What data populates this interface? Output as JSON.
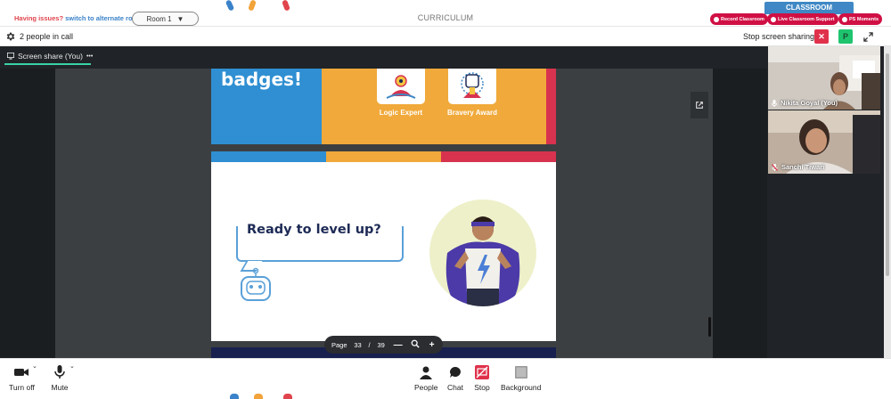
{
  "header": {
    "issues_text": "Having issues?",
    "alt_room_link": "switch to alternate room",
    "room_label": "Room 1",
    "title": "CURRICULUM",
    "classroom_tab": "CLASSROOM",
    "record_button": "Record Classroom",
    "support_button": "Live Classroom Support",
    "moments_button": "PS Moments"
  },
  "callbar": {
    "people_count": "2 people in call",
    "stop_sharing": "Stop screen sharing",
    "p_button": "P"
  },
  "meeting": {
    "share_label": "Screen share (You)",
    "share_more": "•••"
  },
  "slides": {
    "badges_text": "badges!",
    "badge1_label": "Logic Expert",
    "badge2_label": "Bravery Award",
    "ready_text": "Ready to level up?"
  },
  "pager": {
    "page_label": "Page",
    "current": "33",
    "separator": "/",
    "total": "39",
    "zoom_out": "—",
    "zoom_in": "+"
  },
  "participants": [
    {
      "name": "Nikita Goyal (You)",
      "mic": "mic-icon"
    },
    {
      "name": "Sanchi Tiwari",
      "mic": "mic-off-icon"
    }
  ],
  "toolbar": {
    "camera_label": "Turn off",
    "mic_label": "Mute",
    "people_label": "People",
    "chat_label": "Chat",
    "stop_label": "Stop",
    "background_label": "Background"
  },
  "colors": {
    "brand_blue": "#3f88c5",
    "brand_red": "#d01044",
    "slide_orange": "#f0a93a",
    "slide_blue": "#2f8fd2",
    "dark_bg": "#202327",
    "share_accent": "#3ad1a8"
  }
}
